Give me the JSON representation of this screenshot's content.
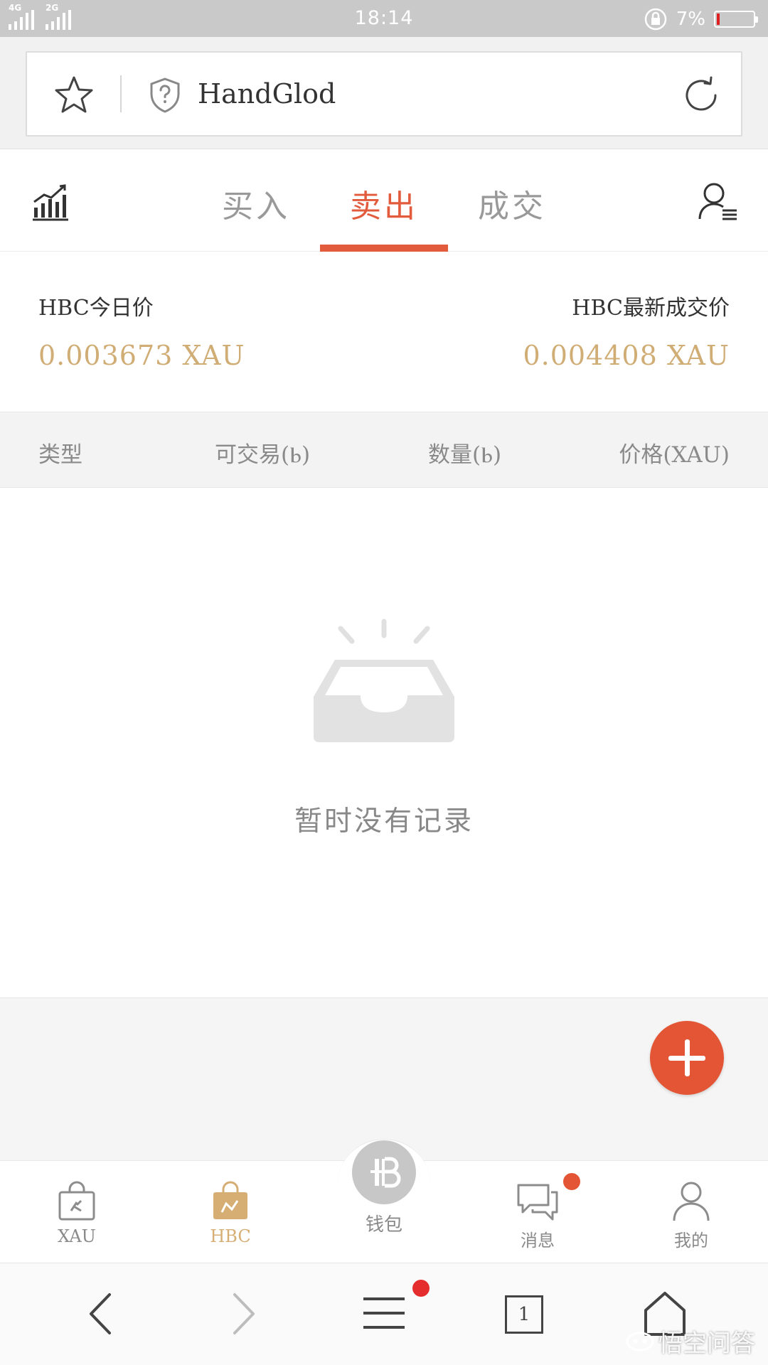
{
  "status_bar": {
    "signal1_label": "4G",
    "signal2_label": "2G",
    "time": "18:14",
    "battery_percent": "7%"
  },
  "url_bar": {
    "site_title": "HandGlod"
  },
  "header": {
    "tabs": [
      {
        "label": "买入",
        "active": false
      },
      {
        "label": "卖出",
        "active": true
      },
      {
        "label": "成交",
        "active": false
      }
    ]
  },
  "price": {
    "today_label": "HBC今日价",
    "today_value": "0.003673 XAU",
    "latest_label": "HBC最新成交价",
    "latest_value": "0.004408 XAU"
  },
  "table": {
    "columns": [
      "类型",
      "可交易(Ⱃ)",
      "数量(Ⱃ)",
      "价格(XAU)"
    ]
  },
  "empty_state": {
    "message": "暂时没有记录"
  },
  "bottom_nav": {
    "items": [
      {
        "label": "XAU",
        "icon": "xau-bag-icon",
        "active": false
      },
      {
        "label": "HBC",
        "icon": "hbc-bag-icon",
        "active": true
      },
      {
        "label": "钱包",
        "icon": "wallet-icon",
        "active": false
      },
      {
        "label": "消息",
        "icon": "message-icon",
        "active": false,
        "badge": true
      },
      {
        "label": "我的",
        "icon": "profile-icon",
        "active": false
      }
    ]
  },
  "browser_toolbar": {
    "tab_count": "1"
  },
  "watermark": {
    "text": "悟空问答"
  },
  "colors": {
    "accent": "#e25b3d",
    "gold": "#d1ad76",
    "fab": "#e35535"
  }
}
